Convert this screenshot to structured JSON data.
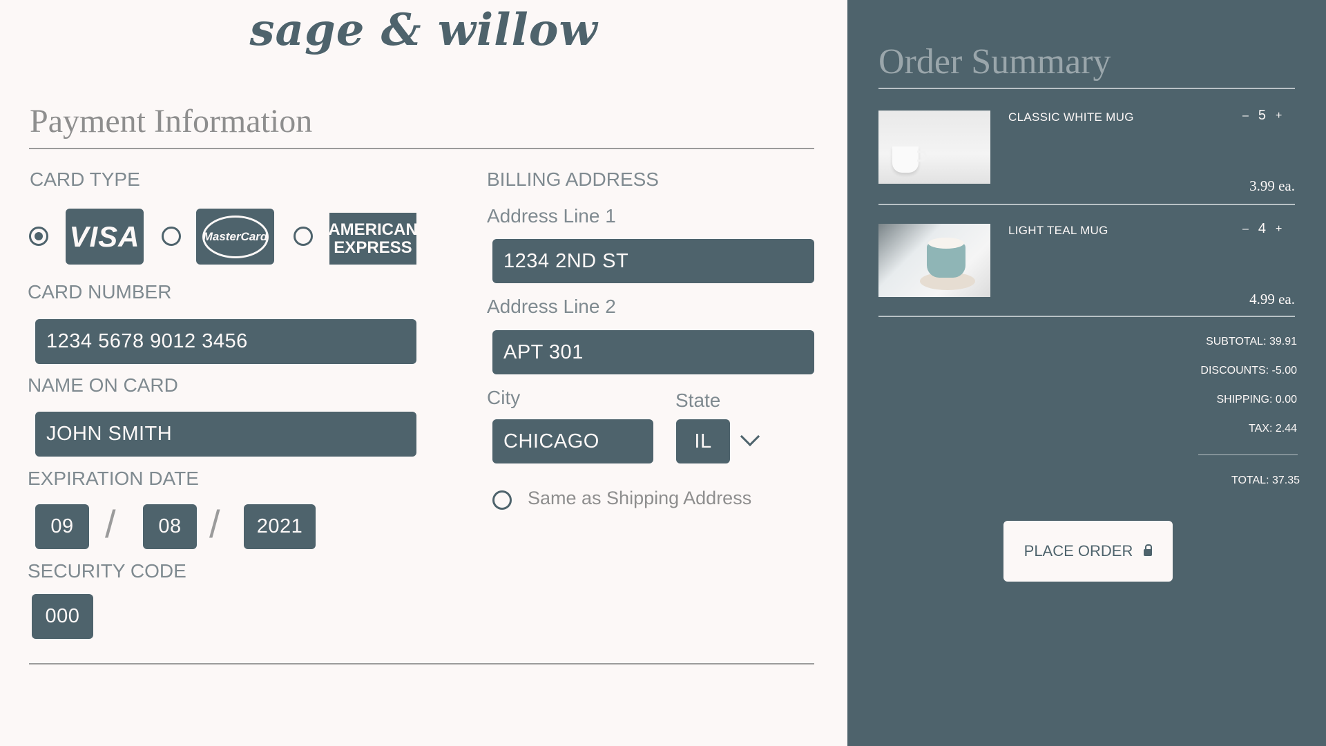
{
  "brand": "sage & willow",
  "payment": {
    "title": "Payment Information",
    "card_type_label": "CARD TYPE",
    "card_types": [
      {
        "name": "VISA",
        "selected": true
      },
      {
        "name": "MasterCard",
        "selected": false
      },
      {
        "name": "AMERICAN EXPRESS",
        "selected": false
      }
    ],
    "amex_line1": "AMERICAN",
    "amex_line2": "EXPRESS",
    "card_number_label": "CARD NUMBER",
    "card_number": "1234 5678 9012 3456",
    "name_label": "NAME ON CARD",
    "name": "JOHN SMITH",
    "expiration_label": "EXPIRATION DATE",
    "exp_month": "09",
    "exp_day": "08",
    "exp_year": "2021",
    "exp_separator": "/",
    "security_label": "SECURITY CODE",
    "security_code": "000"
  },
  "billing": {
    "title": "BILLING ADDRESS",
    "line1_label": "Address Line 1",
    "line1": "1234 2ND ST",
    "line2_label": "Address Line 2",
    "line2": "APT 301",
    "city_label": "City",
    "city": "CHICAGO",
    "state_label": "State",
    "state": "IL",
    "same_as_shipping": "Same as Shipping Address"
  },
  "order": {
    "title": "Order Summary",
    "items": [
      {
        "name": "CLASSIC WHITE MUG",
        "qty": "5",
        "price": "3.99 ea."
      },
      {
        "name": "LIGHT TEAL MUG",
        "qty": "4",
        "price": "4.99 ea."
      }
    ],
    "minus": "–",
    "plus": "+",
    "subtotal": "SUBTOTAL: 39.91",
    "discounts": "DISCOUNTS: -5.00",
    "shipping": "SHIPPING: 0.00",
    "tax": "TAX: 2.44",
    "total": "TOTAL:  37.35",
    "place_order": "PLACE ORDER"
  },
  "colors": {
    "slate": "#4e636c",
    "cream": "#fcf8f7",
    "muted": "#8e8e8e"
  },
  "icons": [
    "lock-icon",
    "chevron-down-icon"
  ]
}
